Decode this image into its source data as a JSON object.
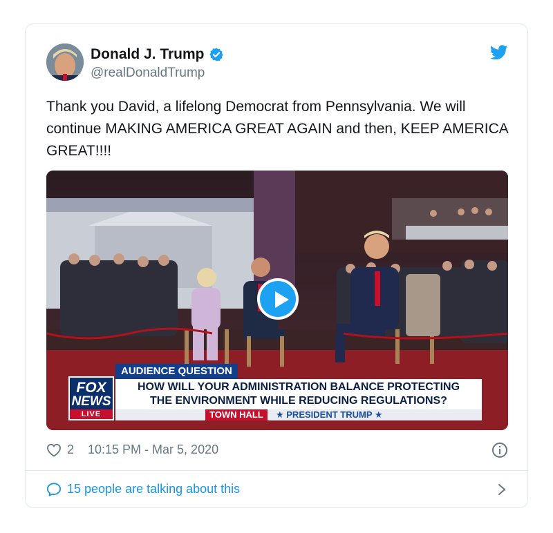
{
  "tweet": {
    "author_name": "Donald J. Trump",
    "author_handle": "@realDonaldTrump",
    "text": "Thank you David, a lifelong Democrat from Pennsylvania. We will continue MAKING AMERICA GREAT AGAIN and then, KEEP AMERICA GREAT!!!!",
    "likes": "2",
    "timestamp": "10:15 PM - Mar 5, 2020",
    "talking_label": "15 people are talking about this"
  },
  "video": {
    "chyron_label": "AUDIENCE QUESTION",
    "question_line1": "HOW WILL YOUR ADMINISTRATION BALANCE PROTECTING",
    "question_line2": "THE ENVIRONMENT WHILE REDUCING REGULATIONS?",
    "bar_left": "TOWN HALL",
    "bar_right": "★ PRESIDENT TRUMP ★",
    "logo_fox": "FOX",
    "logo_news": "NEWS",
    "logo_live": "LIVE"
  },
  "icons": {
    "verified": "verified-badge-icon",
    "platform": "twitter-bird-icon",
    "play": "play-icon",
    "like": "heart-icon",
    "info": "info-icon",
    "reply": "speech-bubble-icon",
    "more": "chevron-right-icon"
  },
  "colors": {
    "accent": "#1da1f2",
    "link": "#1b95e0",
    "muted": "#657786",
    "border": "#e1e8ed",
    "fox_blue": "#0a2f6b",
    "fox_red": "#c8102e"
  }
}
